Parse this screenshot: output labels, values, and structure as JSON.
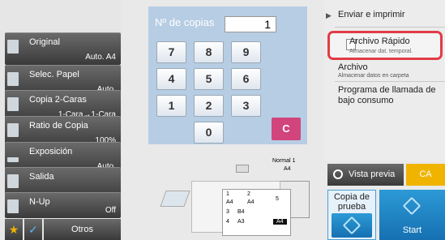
{
  "left_panel": {
    "original": {
      "label": "Original",
      "value": "Auto.   A4"
    },
    "papel": {
      "label": "Selec. Papel",
      "value": "Auto."
    },
    "copia2": {
      "label": "Copia 2-Caras",
      "value": "1-Cara→1-Cara"
    },
    "ratio": {
      "label": "Ratio de Copia",
      "value": "100%"
    },
    "exposicion": {
      "label": "Exposición",
      "value": "Auto."
    },
    "salida": {
      "label": "Salida",
      "value": ""
    },
    "nup": {
      "label": "N-Up",
      "value": "Off"
    },
    "otros": "Otros"
  },
  "keypad": {
    "copies_label": "Nº de copias",
    "copies_value": "1",
    "keys": [
      "7",
      "8",
      "9",
      "4",
      "5",
      "6",
      "1",
      "2",
      "3",
      "0"
    ],
    "clear": "C"
  },
  "machine": {
    "tray_top_label": "Normal 1",
    "tray_top_size": "A4",
    "trays": [
      "1",
      "2",
      "3",
      "4",
      "5"
    ],
    "sizes": [
      "A4",
      "A4",
      "B4",
      "A3",
      "A4"
    ]
  },
  "right_panel": {
    "enviar": "Enviar e imprimir",
    "archivo_rapido": {
      "title": "Archivo Rápido",
      "sub": "Almacenar dat. temporal."
    },
    "archivo": {
      "title": "Archivo",
      "sub": "Almacenar datos en carpeta"
    },
    "programa": "Programa de llamada de bajo consumo",
    "vista_previa": "Vista previa",
    "ca": "CA",
    "copia_prueba": "Copia de prueba",
    "start": "Start"
  },
  "colors": {
    "accent_blue": "#1a7fc4",
    "highlight_red": "#e13c46",
    "ca_yellow": "#f0b400",
    "clear_pink": "#d1457c"
  }
}
